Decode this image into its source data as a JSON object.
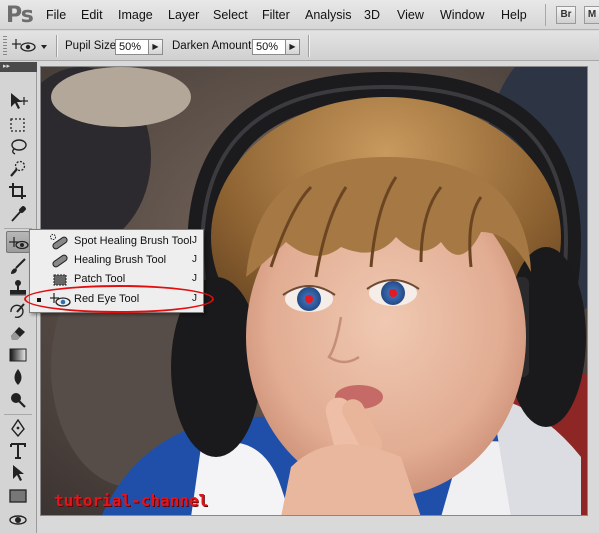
{
  "app": {
    "logo": "Ps"
  },
  "menu": {
    "items": [
      "File",
      "Edit",
      "Image",
      "Layer",
      "Select",
      "Filter",
      "Analysis",
      "3D",
      "View",
      "Window",
      "Help"
    ],
    "bridge_button": "Br",
    "mini_button": "M"
  },
  "options": {
    "pupil_size_label": "Pupil Size:",
    "pupil_size_value": "50%",
    "darken_amount_label": "Darken Amount:",
    "darken_amount_value": "50%",
    "dropdown_arrow": "▶"
  },
  "tools_panel": {
    "collapse_glyph": "▸▸"
  },
  "flyout": {
    "items": [
      {
        "label": "Spot Healing Brush Tool",
        "shortcut": "J",
        "icon": "spot-healing-brush-icon"
      },
      {
        "label": "Healing Brush Tool",
        "shortcut": "J",
        "icon": "healing-brush-icon"
      },
      {
        "label": "Patch Tool",
        "shortcut": "J",
        "icon": "patch-icon"
      },
      {
        "label": "Red Eye Tool",
        "shortcut": "J",
        "icon": "red-eye-icon",
        "selected": true
      }
    ]
  },
  "watermark": "tutorial-channel",
  "colors": {
    "highlight": "#e30d0d",
    "watermark": "#e3141b",
    "iris": "#4d7fbf",
    "shirt_blue": "#1f4fa8"
  }
}
